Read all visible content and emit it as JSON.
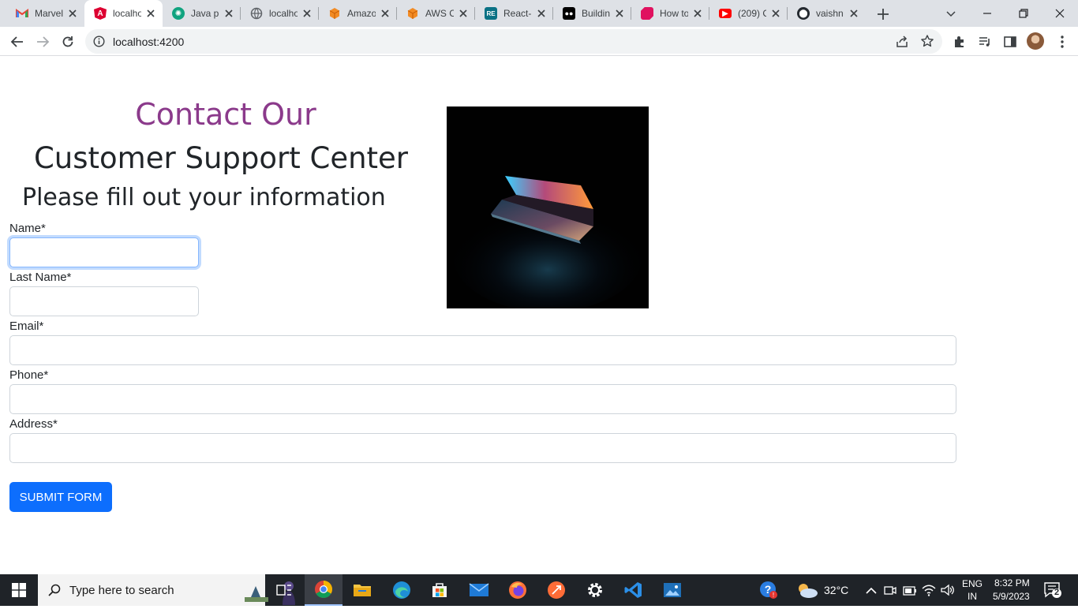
{
  "browser": {
    "tabs": [
      {
        "title": "Marvel",
        "favicon": "gmail-icon",
        "color": "#ea4335"
      },
      {
        "title": "localhost",
        "favicon": "angular-icon",
        "color": "#dd0031"
      },
      {
        "title": "Java pr",
        "favicon": "chatgpt-icon",
        "color": "#10a37f"
      },
      {
        "title": "localhost",
        "favicon": "globe-icon",
        "color": "#5f6368"
      },
      {
        "title": "Amazon",
        "favicon": "aws-icon",
        "color": "#f28b24"
      },
      {
        "title": "AWS C",
        "favicon": "aws-icon",
        "color": "#f28b24"
      },
      {
        "title": "React-",
        "favicon": "react-icon",
        "color": "#0b7285"
      },
      {
        "title": "Building",
        "favicon": "medium-icon",
        "color": "#000000"
      },
      {
        "title": "How to",
        "favicon": "ruby-icon",
        "color": "#e0115f"
      },
      {
        "title": "(209) C",
        "favicon": "youtube-icon",
        "color": "#ff0000"
      },
      {
        "title": "vaishn",
        "favicon": "github-icon",
        "color": "#24292f"
      }
    ],
    "url": "localhost:4200"
  },
  "page": {
    "heading_contact": "Contact Our",
    "heading_center": "Customer Support Center",
    "heading_fill": "Please fill out your information",
    "fields": {
      "name": {
        "label": "Name*",
        "value": ""
      },
      "last_name": {
        "label": "Last Name*",
        "value": ""
      },
      "email": {
        "label": "Email*",
        "value": ""
      },
      "phone": {
        "label": "Phone*",
        "value": ""
      },
      "address": {
        "label": "Address*",
        "value": ""
      }
    },
    "submit_label": "SUBMIT FORM",
    "accent_color": "#8b3a8b",
    "button_color": "#0d6efd"
  },
  "taskbar": {
    "search_placeholder": "Type here to search",
    "weather": "32°C",
    "lang_line1": "ENG",
    "lang_line2": "IN",
    "time": "8:32 PM",
    "date": "5/9/2023",
    "notification_count": "2"
  }
}
